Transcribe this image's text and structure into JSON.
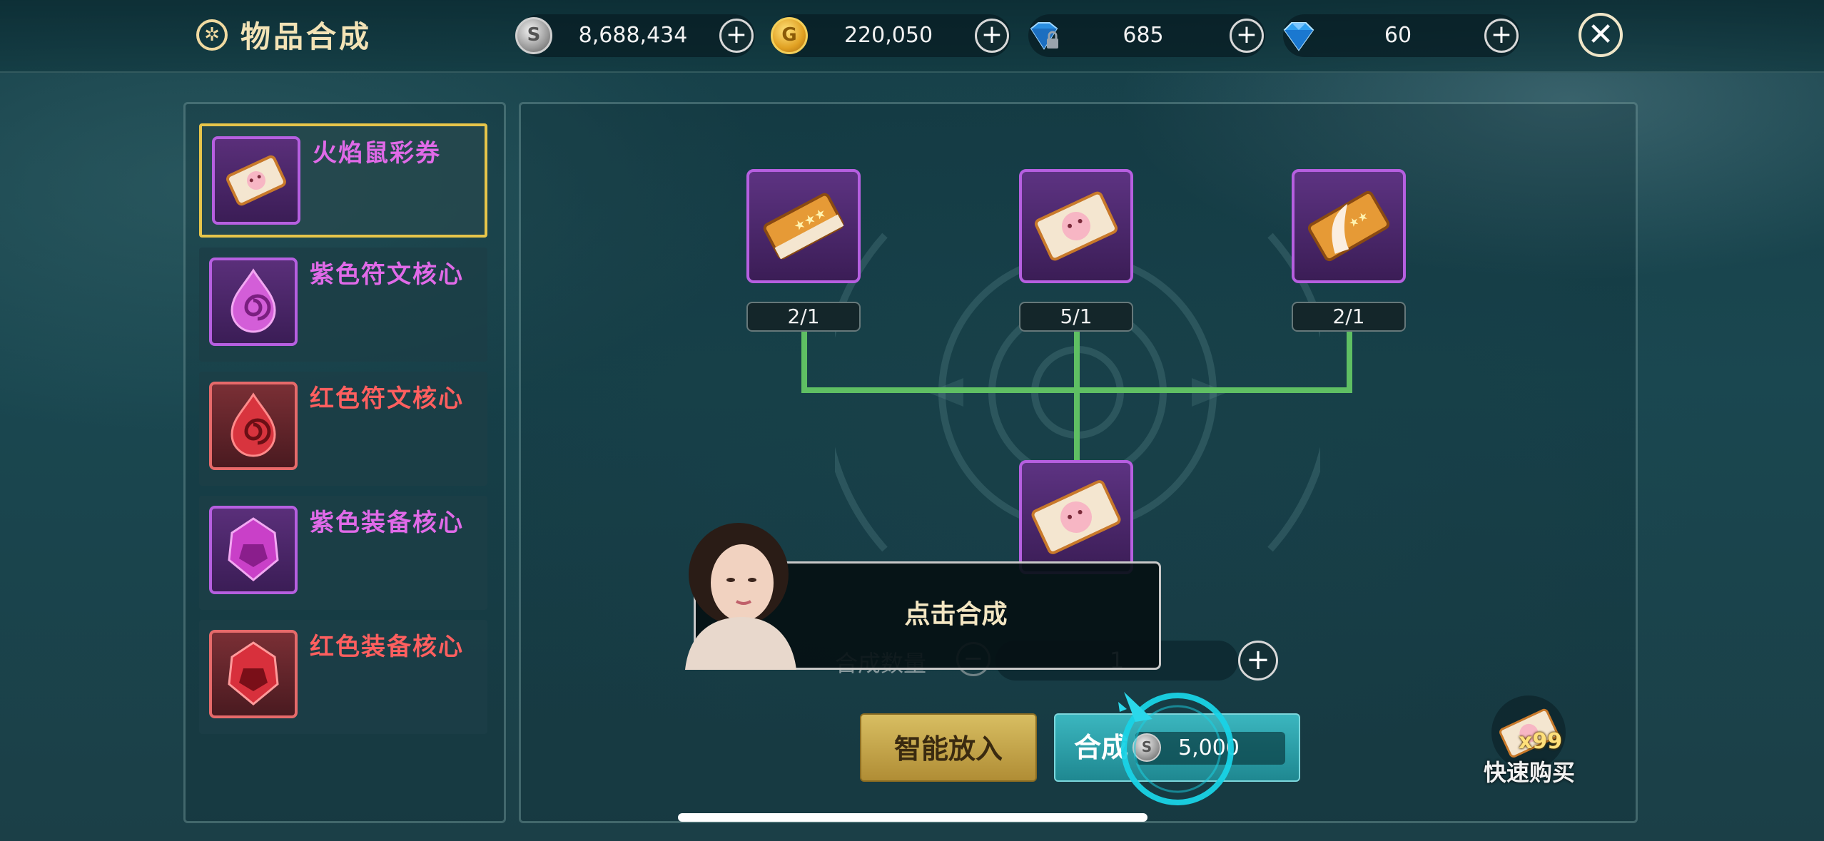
{
  "header": {
    "title": "物品合成",
    "currencies": [
      {
        "icon": "silver-coin-icon",
        "value": "8,688,434"
      },
      {
        "icon": "gold-coin-icon",
        "value": "220,050"
      },
      {
        "icon": "locked-diamond-icon",
        "value": "685"
      },
      {
        "icon": "diamond-icon",
        "value": "60"
      }
    ],
    "plus_label": "+",
    "close_label": "✕"
  },
  "sidebar": {
    "items": [
      {
        "label": "火焰鼠彩券",
        "color": "#e06ae8",
        "frame": "purple"
      },
      {
        "label": "紫色符文核心",
        "color": "#e06ae8",
        "frame": "purple"
      },
      {
        "label": "红色符文核心",
        "color": "#ff5f5f",
        "frame": "red"
      },
      {
        "label": "紫色装备核心",
        "color": "#e06ae8",
        "frame": "purple"
      },
      {
        "label": "红色装备核心",
        "color": "#ff5f5f",
        "frame": "red"
      }
    ]
  },
  "recipe": {
    "materials": [
      {
        "count": "2/1"
      },
      {
        "count": "5/1"
      },
      {
        "count": "2/1"
      }
    ]
  },
  "quantity": {
    "label": "合成数量",
    "value": "1",
    "minus": "−",
    "plus": "+"
  },
  "buttons": {
    "smart_place": "智能放入",
    "synthesize": "合成",
    "cost": "5,000"
  },
  "quick_buy": {
    "badge": "x99",
    "label": "快速购买"
  },
  "tutorial": {
    "text": "点击合成"
  },
  "colors": {
    "accent_gold": "#e7c54a",
    "connector_green": "#5fbf63",
    "purple_frame": "#b65fe0",
    "red_frame": "#e66a6a"
  }
}
